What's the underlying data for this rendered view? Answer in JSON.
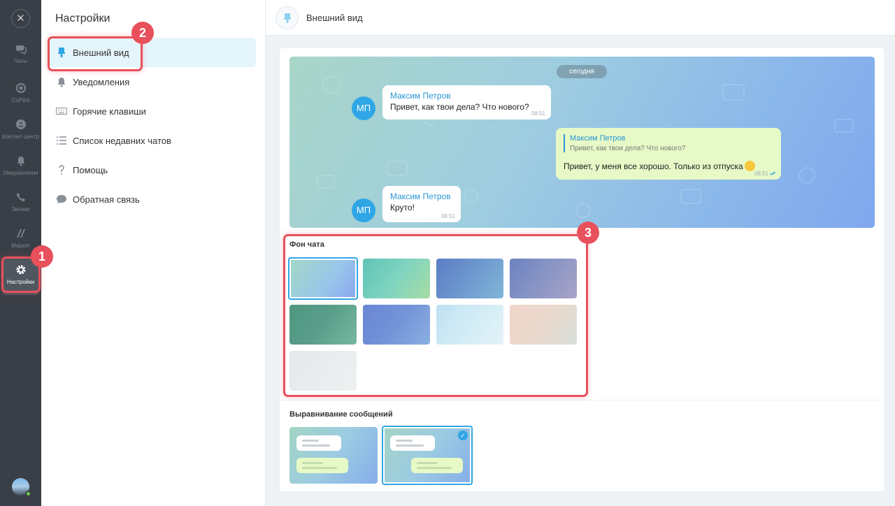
{
  "rail": {
    "close_glyph": "✕",
    "items": [
      {
        "label": "Чаты",
        "icon": "chat-icon"
      },
      {
        "label": "CoPilot",
        "icon": "copilot-icon"
      },
      {
        "label": "Контакт-центр",
        "icon": "contact-center-icon"
      },
      {
        "label": "Уведомления",
        "icon": "bell-icon"
      },
      {
        "label": "Звонки",
        "icon": "phone-icon"
      },
      {
        "label": "Маркет",
        "icon": "market-icon"
      },
      {
        "label": "Настройки",
        "icon": "gear-icon"
      }
    ]
  },
  "menu": {
    "title": "Настройки",
    "items": [
      {
        "label": "Внешний вид",
        "icon": "brush-icon"
      },
      {
        "label": "Уведомления",
        "icon": "bell-icon"
      },
      {
        "label": "Горячие клавиши",
        "icon": "keyboard-icon"
      },
      {
        "label": "Список недавних чатов",
        "icon": "list-icon"
      },
      {
        "label": "Помощь",
        "icon": "question-icon"
      },
      {
        "label": "Обратная связь",
        "icon": "speech-bubble-icon"
      }
    ]
  },
  "header": {
    "title": "Внешний вид",
    "icon": "brush-icon"
  },
  "preview": {
    "date": "сегодня",
    "avatar_initials": "МП",
    "messages": [
      {
        "author": "Максим Петров",
        "text": "Привет, как твои дела? Что нового?",
        "time": "08:51"
      },
      {
        "quote_author": "Максим Петров",
        "quote_text": "Привет, как твои дела? Что нового?",
        "text": "Привет, у меня все хорошо. Только из отпуска",
        "time": "08:51"
      },
      {
        "author": "Максим Петров",
        "text": "Круто!",
        "time": "08:51"
      }
    ]
  },
  "background": {
    "title": "Фон чата",
    "swatches": [
      "#a9cde6",
      "#7fcfb8",
      "#6e95cc",
      "#8995c4",
      "#5a9e8a",
      "#7493d8",
      "#cfe9f4",
      "#ead8cc",
      "#e7ecee"
    ]
  },
  "alignment": {
    "title": "Выравнивание сообщений",
    "selected_index": 1
  },
  "annotations": {
    "badge1": "1",
    "badge2": "2",
    "badge3": "3"
  },
  "colors": {
    "accent": "#2fa6e6",
    "highlight": "#e8505b",
    "rail_bg": "#3a3f47"
  }
}
